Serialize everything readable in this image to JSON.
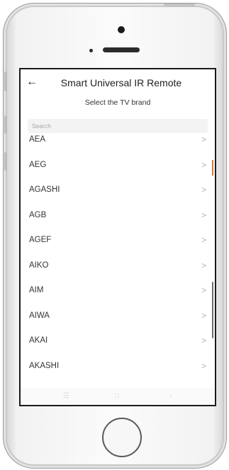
{
  "app": {
    "title": "Smart Universal IR Remote",
    "subtitle": "Select the TV brand",
    "back_icon": "←"
  },
  "search": {
    "placeholder": "Search"
  },
  "brands": [
    {
      "label": "AEA"
    },
    {
      "label": "AEG"
    },
    {
      "label": "AGASHI"
    },
    {
      "label": "AGB"
    },
    {
      "label": "AGEF"
    },
    {
      "label": "AIKO"
    },
    {
      "label": "AIM"
    },
    {
      "label": "AIWA"
    },
    {
      "label": "AKAI"
    },
    {
      "label": "AKASHI"
    }
  ],
  "chevron_glyph": ">",
  "colors": {
    "accent": "#e07a3a",
    "text": "#333333",
    "chevron": "#b0b0b0"
  }
}
